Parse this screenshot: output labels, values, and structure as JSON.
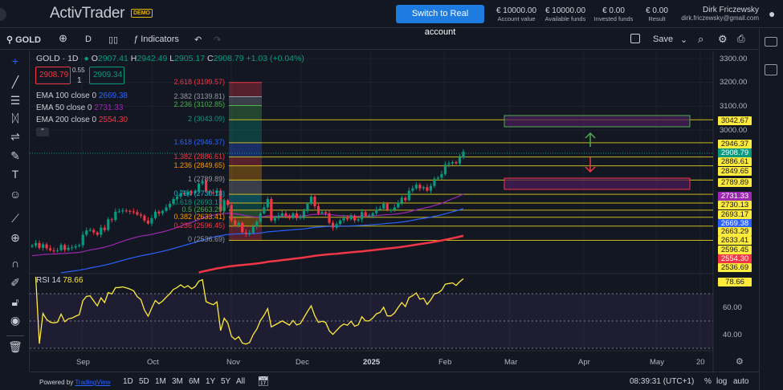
{
  "header": {
    "logo": "ActivTrader",
    "demo_badge": "DEMO",
    "switch_button": "Switch to Real account",
    "stats": [
      {
        "value": "€ 10000.00",
        "label": "Account value"
      },
      {
        "value": "€ 10000.00",
        "label": "Available funds"
      },
      {
        "value": "€ 0.00",
        "label": "Invested funds"
      },
      {
        "value": "€ 0.00",
        "label": "Result"
      }
    ],
    "user_name": "Dirk Friczewsky",
    "user_email": "dirk.friczewsky@gmail.com"
  },
  "toolbar": {
    "symbol": "GOLD",
    "interval": "D",
    "indicators": "Indicators",
    "save": "Save"
  },
  "legend": {
    "title": "GOLD · 1D",
    "o_label": "O",
    "o": "2907.41",
    "h_label": "H",
    "h": "2942.49",
    "l_label": "L",
    "l": "2905.17",
    "c_label": "C",
    "c": "2908.79",
    "change": "+1.03 (+0.04%)",
    "sell": "2908.79",
    "spread": "0.55",
    "qty": "1",
    "buy": "2909.34",
    "emas": [
      {
        "label": "EMA 100 close 0",
        "value": "2669.38",
        "color": "#2962ff"
      },
      {
        "label": "EMA 50 close 0",
        "value": "2731.33",
        "color": "#9c27b0"
      },
      {
        "label": "EMA 200 close 0",
        "value": "2554.30",
        "color": "#f23645"
      }
    ],
    "rsi_label": "RSI 14",
    "rsi_value": "78.66"
  },
  "price_axis": [
    "3300.00",
    "3200.00",
    "3100.00",
    "3000.00"
  ],
  "rsi_axis": [
    "60.00",
    "40.00"
  ],
  "price_tags": [
    {
      "v": "3042.67",
      "bg": "#ffeb3b",
      "fg": "#131722"
    },
    {
      "v": "2946.37",
      "bg": "#ffeb3b",
      "fg": "#131722"
    },
    {
      "v": "2908.79",
      "bg": "#089981",
      "fg": "#ffffff"
    },
    {
      "v": "2886.61",
      "bg": "#ffeb3b",
      "fg": "#131722"
    },
    {
      "v": "2849.65",
      "bg": "#ffeb3b",
      "fg": "#131722"
    },
    {
      "v": "2789.89",
      "bg": "#ffeb3b",
      "fg": "#131722"
    },
    {
      "v": "2731.33",
      "bg": "#9c27b0",
      "fg": "#ffffff"
    },
    {
      "v": "2730.13",
      "bg": "#ffeb3b",
      "fg": "#131722"
    },
    {
      "v": "2693.17",
      "bg": "#ffeb3b",
      "fg": "#131722"
    },
    {
      "v": "2669.38",
      "bg": "#2962ff",
      "fg": "#ffffff"
    },
    {
      "v": "2663.29",
      "bg": "#ffeb3b",
      "fg": "#131722"
    },
    {
      "v": "2633.41",
      "bg": "#ffeb3b",
      "fg": "#131722"
    },
    {
      "v": "2596.45",
      "bg": "#ffeb3b",
      "fg": "#131722"
    },
    {
      "v": "2554.30",
      "bg": "#f23645",
      "fg": "#ffffff"
    },
    {
      "v": "2536.69",
      "bg": "#ffeb3b",
      "fg": "#131722"
    },
    {
      "v": "78.66",
      "bg": "#ffeb3b",
      "fg": "#131722"
    }
  ],
  "fib_levels": [
    {
      "label": "2.618 (3199.57)",
      "price": 3199.57,
      "color": "#f23645"
    },
    {
      "label": "2.382 (3139.81)",
      "price": 3139.81,
      "color": "#9598a1"
    },
    {
      "label": "2.236 (3102.85)",
      "price": 3102.85,
      "color": "#4caf50"
    },
    {
      "label": "2 (3043.09)",
      "price": 3043.09,
      "color": "#089981"
    },
    {
      "label": "1.618 (2946.37)",
      "price": 2946.37,
      "color": "#2962ff"
    },
    {
      "label": "1.382 (2886.61)",
      "price": 2886.61,
      "color": "#f23645"
    },
    {
      "label": "1.236 (2849.65)",
      "price": 2849.65,
      "color": "#ff9800"
    },
    {
      "label": "1 (2789.89)",
      "price": 2789.89,
      "color": "#9598a1"
    },
    {
      "label": "0.764 (2730.13)",
      "price": 2730.13,
      "color": "#00bcd4"
    },
    {
      "label": "0.618 (2693.17)",
      "price": 2693.17,
      "color": "#089981"
    },
    {
      "label": "0.5 (2663.29)",
      "price": 2663.29,
      "color": "#4caf50"
    },
    {
      "label": "0.382 (2633.41)",
      "price": 2633.41,
      "color": "#ff9800"
    },
    {
      "label": "0.236 (2596.45)",
      "price": 2596.45,
      "color": "#f23645"
    },
    {
      "label": "0 (2536.69)",
      "price": 2536.69,
      "color": "#9598a1"
    }
  ],
  "time_axis": [
    "Sep",
    "Oct",
    "Nov",
    "Dec",
    "2025",
    "Feb",
    "Mar",
    "Apr",
    "May",
    "20"
  ],
  "bottom": {
    "powered": "Powered by",
    "tv": "TradingView",
    "ranges": [
      "1D",
      "5D",
      "1M",
      "3M",
      "6M",
      "1Y",
      "5Y",
      "All"
    ],
    "clock": "08:39:31 (UTC+1)",
    "pct": "%",
    "log": "log",
    "auto": "auto"
  },
  "chart_data": {
    "type": "candlestick",
    "symbol": "GOLD",
    "interval": "1D",
    "ylim": [
      2480,
      3320
    ],
    "rsi_ylim": [
      20,
      90
    ],
    "closes": [
      2515,
      2525,
      2505,
      2520,
      2503,
      2495,
      2493,
      2495,
      2517,
      2497,
      2505,
      2507,
      2512,
      2516,
      2560,
      2578,
      2580,
      2570,
      2560,
      2590,
      2580,
      2625,
      2622,
      2657,
      2658,
      2662,
      2660,
      2658,
      2655,
      2645,
      2640,
      2620,
      2607,
      2630,
      2657,
      2650,
      2660,
      2675,
      2690,
      2710,
      2720,
      2735,
      2730,
      2740,
      2735,
      2745,
      2775,
      2785,
      2742,
      2738,
      2735,
      2745,
      2660,
      2705,
      2685,
      2620,
      2600,
      2610,
      2570,
      2563,
      2568,
      2595,
      2615,
      2650,
      2675,
      2710,
      2620,
      2630,
      2640,
      2650,
      2640,
      2630,
      2650,
      2630,
      2635,
      2660,
      2690,
      2720,
      2680,
      2650,
      2655,
      2650,
      2610,
      2590,
      2605,
      2620,
      2630,
      2625,
      2640,
      2620,
      2625,
      2655,
      2640,
      2640,
      2650,
      2665,
      2670,
      2690,
      2665,
      2665,
      2675,
      2695,
      2715,
      2705,
      2745,
      2755,
      2770,
      2755,
      2760,
      2745,
      2765,
      2795,
      2800,
      2815,
      2855,
      2860,
      2865,
      2860,
      2885,
      2909
    ]
  }
}
